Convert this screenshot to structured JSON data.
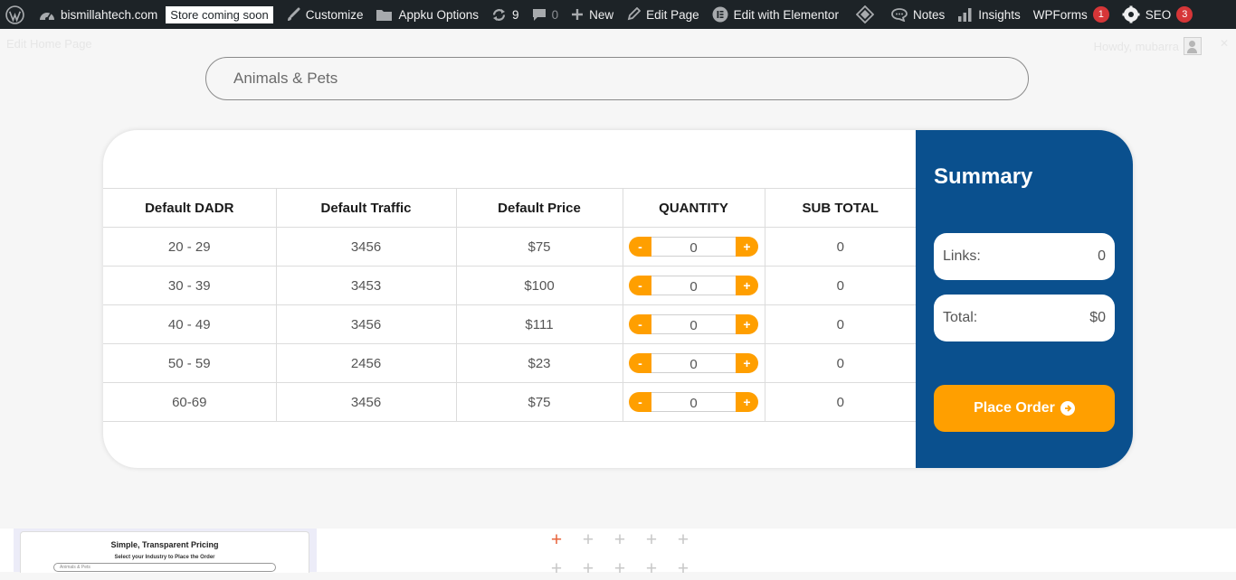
{
  "adminbar": {
    "site_name": "bismillahtech.com",
    "store_badge": "Store coming soon",
    "customize": "Customize",
    "appku_options": "Appku Options",
    "updates_count": "9",
    "comments_count": "0",
    "new": "New",
    "edit_page": "Edit Page",
    "edit_elementor": "Edit with Elementor",
    "notes": "Notes",
    "insights": "Insights",
    "wpforms": "WPForms",
    "wpforms_badge": "1",
    "seo": "SEO",
    "seo_badge": "3"
  },
  "page": {
    "edit_link": "Edit Home Page",
    "howdy": "Howdy, mubarra"
  },
  "industry_select": {
    "value": "Animals & Pets"
  },
  "table": {
    "headers": [
      "Default DADR",
      "Default Traffic",
      "Default Price",
      "QUANTITY",
      "SUB TOTAL"
    ],
    "rows": [
      {
        "dadr": "20 - 29",
        "traffic": "3456",
        "price": "$75",
        "qty": "0",
        "subtotal": "0"
      },
      {
        "dadr": "30 - 39",
        "traffic": "3453",
        "price": "$100",
        "qty": "0",
        "subtotal": "0"
      },
      {
        "dadr": "40 - 49",
        "traffic": "3456",
        "price": "$111",
        "qty": "0",
        "subtotal": "0"
      },
      {
        "dadr": "50 - 59",
        "traffic": "2456",
        "price": "$23",
        "qty": "0",
        "subtotal": "0"
      },
      {
        "dadr": "60-69",
        "traffic": "3456",
        "price": "$75",
        "qty": "0",
        "subtotal": "0"
      }
    ],
    "minus_label": "-",
    "plus_label": "+"
  },
  "summary": {
    "title": "Summary",
    "links_label": "Links:",
    "links_value": "0",
    "total_label": "Total:",
    "total_value": "$0",
    "place_order": "Place Order"
  },
  "preview": {
    "title": "Simple, Transparent Pricing",
    "subtitle": "Select your Industry to Place the Order",
    "input_value": "Animals & Pets"
  },
  "colors": {
    "adminbar_bg": "#1d2327",
    "summary_bg": "#0a508e",
    "accent_orange": "#ff9f00",
    "badge_red": "#d63638"
  }
}
